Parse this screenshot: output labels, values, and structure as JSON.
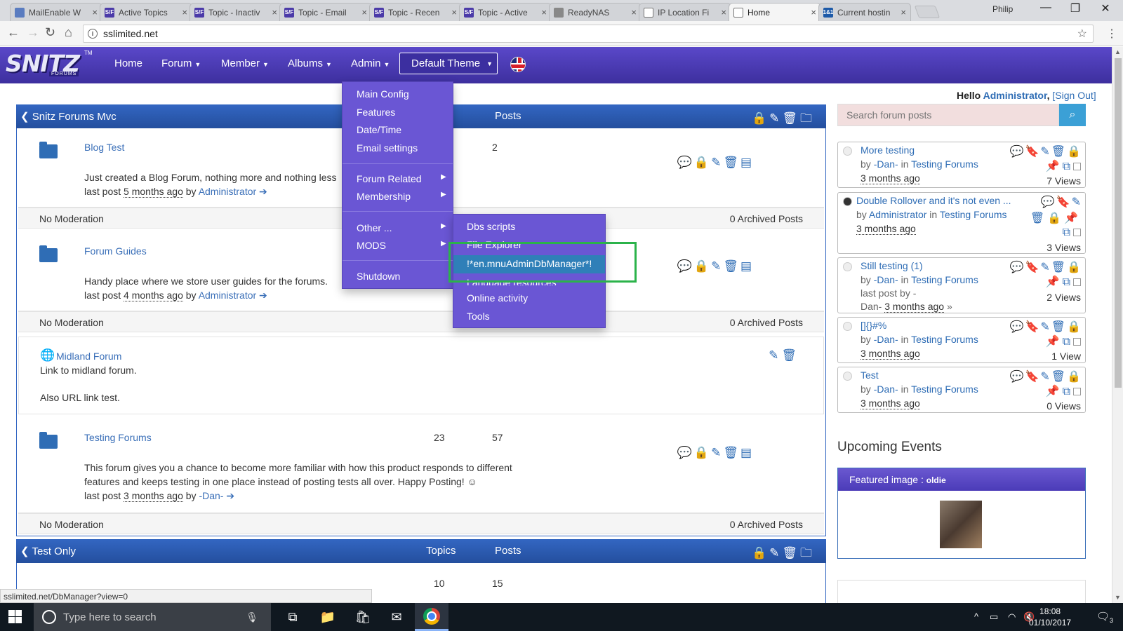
{
  "browser": {
    "tabs": [
      {
        "title": "MailEnable W",
        "favicon": "me"
      },
      {
        "title": "Active Topics",
        "favicon": "sf"
      },
      {
        "title": "Topic - Inactiv",
        "favicon": "sf"
      },
      {
        "title": "Topic - Email",
        "favicon": "sf"
      },
      {
        "title": "Topic - Recen",
        "favicon": "sf"
      },
      {
        "title": "Topic - Active",
        "favicon": "sf"
      },
      {
        "title": "ReadyNAS",
        "favicon": "gray"
      },
      {
        "title": "IP Location Fi",
        "favicon": "doc"
      },
      {
        "title": "Home",
        "favicon": "doc",
        "active": true
      },
      {
        "title": "Current hostin",
        "favicon": "ionos"
      }
    ],
    "profile": "Philip",
    "url": "sslimited.net",
    "status_url": "sslimited.net/DbManager?view=0"
  },
  "site": {
    "logo_text": "SNITZ",
    "logo_sub": "FORUMS",
    "logo_tm": "TM",
    "nav": [
      "Home",
      "Forum",
      "Member",
      "Albums",
      "Admin"
    ],
    "theme": "Default Theme"
  },
  "admin_menu": {
    "items": [
      "Main Config",
      "Features",
      "Date/Time",
      "Email settings"
    ],
    "sub_items": [
      "Forum Related",
      "Membership"
    ],
    "other_items": [
      "Other ...",
      "MODS"
    ],
    "shutdown": "Shutdown"
  },
  "other_menu": {
    "items": [
      "Dbs scripts",
      "File Explorer",
      "!*en.mnuAdminDbManager*!",
      "Language resources",
      "Online activity",
      "Tools"
    ]
  },
  "category1": {
    "title": "Snitz Forums Mvc",
    "col_posts": "Posts",
    "forums": [
      {
        "title": "Blog Test",
        "topics": "",
        "posts": "2",
        "desc": "Just created a Blog Forum, nothing more and nothing less",
        "last_label": "last post",
        "ago": "5 months ago",
        "by": "by",
        "author": "Administrator",
        "moderation": "No Moderation",
        "archived": "0 Archived Posts"
      },
      {
        "title": "Forum Guides",
        "topics": "",
        "posts": "",
        "desc": "Handy place where we store user guides for the forums.",
        "last_label": "last post",
        "ago": "4 months ago",
        "by": "by",
        "author": "Administrator",
        "moderation": "No Moderation",
        "archived": "0 Archived Posts"
      },
      {
        "title": "Testing Forums",
        "topics": "23",
        "posts": "57",
        "desc_line1": "This forum gives you a chance to become more familiar with how this product responds to different",
        "desc_line2": "features and keeps testing in one place instead of posting tests all over. Happy Posting!",
        "last_label": "last post",
        "ago": "3 months ago",
        "by": "by",
        "author": "-Dan-",
        "moderation": "No Moderation",
        "archived": "0 Archived Posts"
      }
    ],
    "link": {
      "title": "Midland Forum",
      "line1": "Link to midland forum.",
      "line2": "Also URL link test."
    }
  },
  "category2": {
    "title": "Test Only",
    "col_topics": "Topics",
    "col_posts": "Posts",
    "topics": "10",
    "posts": "15"
  },
  "sidebar": {
    "hello": "Hello",
    "user": "Administrator",
    "signout": "[Sign Out]",
    "search_placeholder": "Search forum posts",
    "topics": [
      {
        "title": "More testing",
        "by": "by",
        "author": "-Dan-",
        "in": "in",
        "forum": "Testing Forums",
        "ago": "3 months ago",
        "views": "7 Views"
      },
      {
        "title": "Double Rollover and it's not even ...",
        "by": "by",
        "author": "Administrator",
        "in": "in",
        "forum": "Testing Forums",
        "ago": "3 months ago",
        "views": "3 Views"
      },
      {
        "title": "Still testing (1)",
        "by": "by",
        "author": "-Dan-",
        "in": "in",
        "forum": "Testing Forums",
        "last": "last post by -",
        "last2": "Dan-",
        "ago": "3 months ago",
        "more": "»",
        "views": "2 Views"
      },
      {
        "title": "[]{}#%",
        "by": "by",
        "author": "-Dan-",
        "in": "in",
        "forum": "Testing Forums",
        "ago": "3 months ago",
        "views": "1 View"
      },
      {
        "title": "Test",
        "by": "by",
        "author": "-Dan-",
        "in": "in",
        "forum": "Testing Forums",
        "ago": "3 months ago",
        "views": "0 Views"
      }
    ],
    "events_heading": "Upcoming Events",
    "featured_label": "Featured image :",
    "featured_name": "oldie"
  },
  "taskbar": {
    "search_placeholder": "Type here to search",
    "time": "18:08",
    "date": "01/10/2017",
    "notifications": "3"
  },
  "colors": {
    "navbar": "#4b3bb8",
    "category_bar": "#2d5db3",
    "menu": "#6a56d4",
    "menu_selected": "#2f7fb8",
    "highlight_box": "#2bb34a",
    "link": "#3a6fb8"
  }
}
